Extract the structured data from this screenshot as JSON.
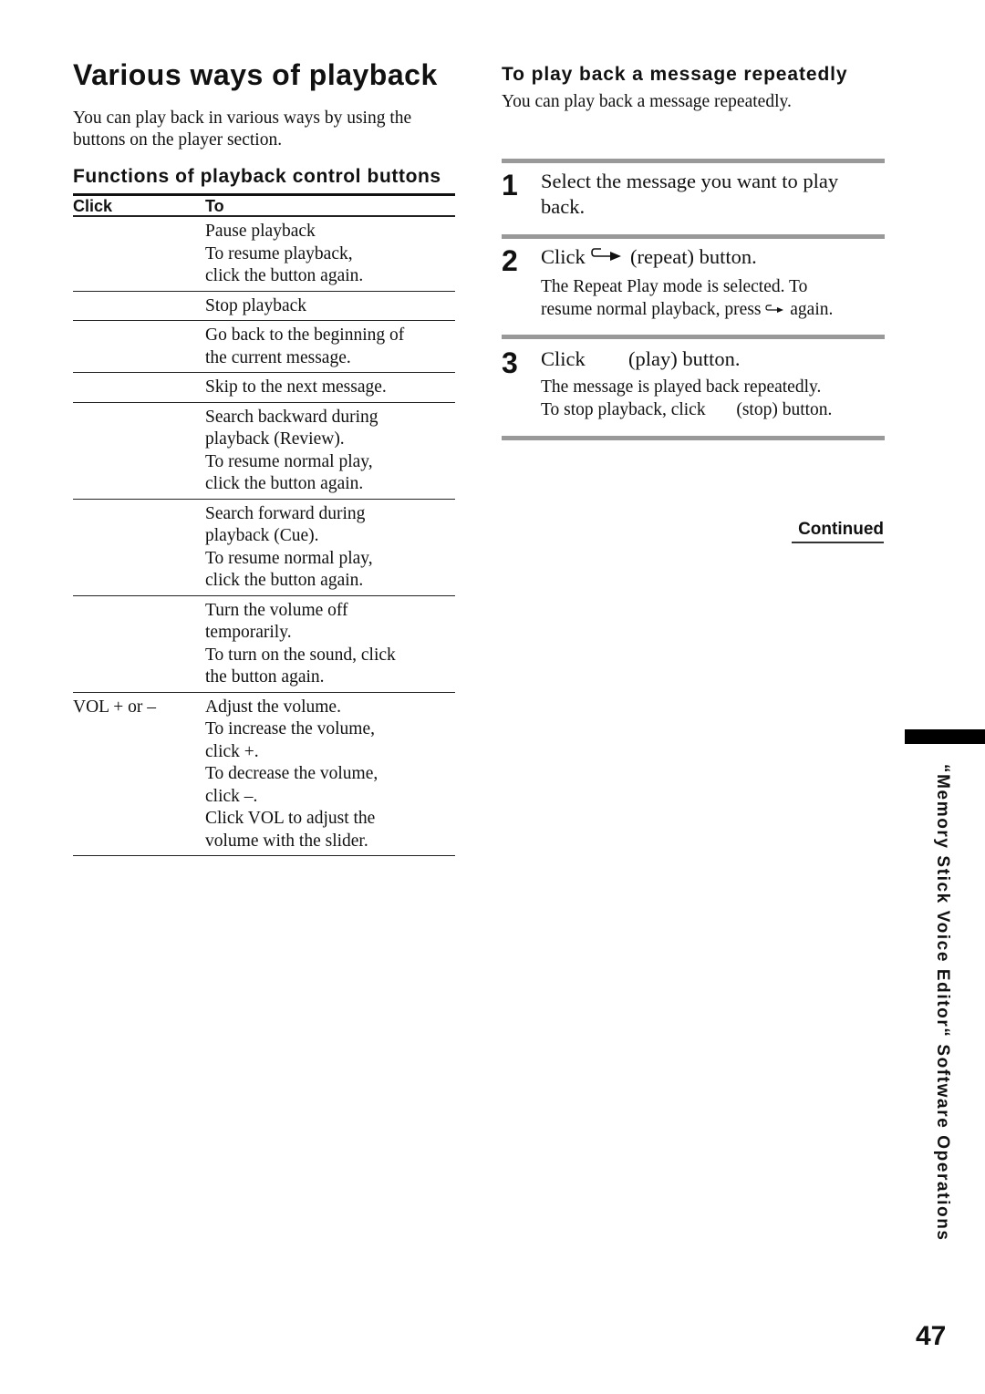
{
  "page": {
    "title": "Various ways of playback",
    "intro": "You can play back in various ways by using the buttons on the player section.",
    "page_number": "47",
    "side_tab": "“Memory Stick Voice Editor“ Software Operations",
    "continued": "Continued"
  },
  "functions": {
    "title": "Functions of playback control buttons",
    "headers": {
      "click": "Click",
      "to": "To"
    },
    "rows": [
      {
        "click": "",
        "lines": [
          "Pause playback",
          "To resume playback,",
          "click the button again."
        ]
      },
      {
        "click": "",
        "lines": [
          "Stop playback"
        ]
      },
      {
        "click": "",
        "lines": [
          "Go back to the beginning of",
          "the current message."
        ]
      },
      {
        "click": "",
        "lines": [
          "Skip to the next message."
        ]
      },
      {
        "click": "",
        "lines": [
          "Search backward during",
          "playback (Review).",
          "To resume normal play,",
          "click the button again."
        ]
      },
      {
        "click": "",
        "lines": [
          "Search forward during",
          "playback (Cue).",
          "To resume normal play,",
          "click the button again."
        ]
      },
      {
        "click": "",
        "lines": [
          "Turn the volume off",
          "temporarily.",
          "To turn on the sound, click",
          "the button again."
        ]
      },
      {
        "click": "VOL + or –",
        "lines": [
          "Adjust the volume.",
          "To increase the volume,",
          "click +.",
          "To decrease the volume,",
          "click –.",
          "Click VOL to adjust the",
          "volume with the slider."
        ]
      }
    ]
  },
  "repeat": {
    "title": "To play back a message repeatedly",
    "intro": "You can play back a message repeatedly.",
    "steps": [
      {
        "num": "1",
        "main": "Select the message you want to play back."
      },
      {
        "num": "2",
        "main_prefix": "Click",
        "icon": "repeat-icon",
        "main_suffix": "(repeat) button.",
        "sub_1": "The Repeat Play mode is selected.  To",
        "sub_2_prefix": "resume normal playback, press",
        "sub_2_suffix": "again."
      },
      {
        "num": "3",
        "main_prefix": "Click",
        "icon": "play-icon",
        "main_suffix": "(play) button.",
        "sub_1": "The message is played back repeatedly.",
        "sub_2_prefix": "To stop playback, click",
        "sub_2_suffix": "(stop) button."
      }
    ]
  }
}
